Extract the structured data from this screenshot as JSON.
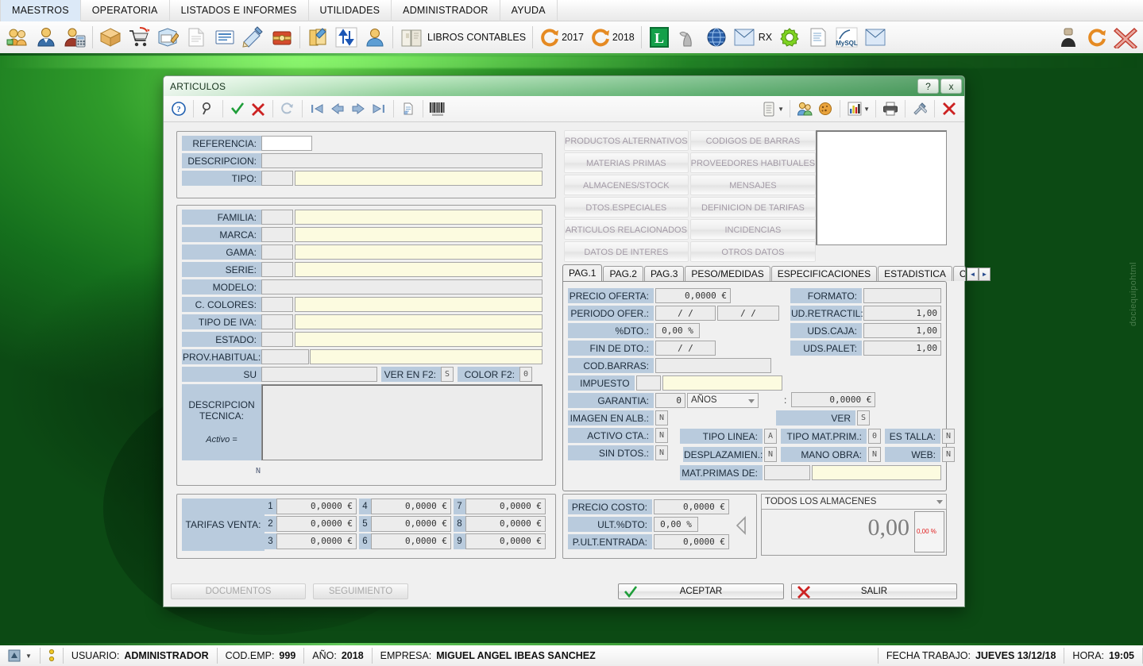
{
  "menubar": {
    "items": [
      "MAESTROS",
      "OPERATORIA",
      "LISTADOS E INFORMES",
      "UTILIDADES",
      "ADMINISTRADOR",
      "AYUDA"
    ]
  },
  "toolbar": {
    "icons": [
      {
        "name": "clientes-icon"
      },
      {
        "name": "proveedores-icon"
      },
      {
        "name": "contabilidad-icon"
      },
      {
        "name": "articulos-icon"
      },
      {
        "name": "compras-carrito-icon"
      },
      {
        "name": "pedidos-icon"
      },
      {
        "name": "albaranes-icon"
      },
      {
        "name": "facturas-icon"
      },
      {
        "name": "firma-icon"
      },
      {
        "name": "caja-icon"
      },
      {
        "name": "agenda-icon"
      },
      {
        "name": "traspasos-icon"
      },
      {
        "name": "usuario-icon"
      }
    ],
    "libros_label": "LIBROS CONTABLES",
    "year_prev": "2017",
    "year_curr": "2018",
    "rx_label": "RX",
    "mysql_label": "MySQL"
  },
  "dialog": {
    "title": "ARTICULOS",
    "help_btn": "?",
    "close_btn": "x",
    "toolbar_icons": [
      {
        "name": "help-icon"
      },
      {
        "name": "search-icon"
      },
      {
        "name": "accept-check-icon"
      },
      {
        "name": "cancel-x-icon"
      },
      {
        "name": "refresh-icon"
      },
      {
        "name": "first-record-icon"
      },
      {
        "name": "prev-record-icon"
      },
      {
        "name": "next-record-icon"
      },
      {
        "name": "last-record-icon"
      },
      {
        "name": "print-preview-icon"
      },
      {
        "name": "barcode-icon"
      }
    ],
    "toolbar_right_icons": [
      {
        "name": "notes-icon"
      },
      {
        "name": "users-icon"
      },
      {
        "name": "cookie-icon"
      },
      {
        "name": "chart-icon"
      },
      {
        "name": "printer-icon"
      },
      {
        "name": "tools-icon"
      },
      {
        "name": "close-red-x-icon"
      }
    ]
  },
  "identification": [
    {
      "label": "REFERENCIA:",
      "value": "",
      "style": "white"
    },
    {
      "label": "DESCRIPCION:",
      "value": "",
      "style": "grey"
    },
    {
      "label": "TIPO:",
      "code": "",
      "value": "",
      "style": "yellow"
    }
  ],
  "classification": [
    {
      "label": "FAMILIA:",
      "code": "",
      "value": "",
      "style": "yellow"
    },
    {
      "label": "MARCA:",
      "code": "",
      "value": "",
      "style": "yellow"
    },
    {
      "label": "GAMA:",
      "code": "",
      "value": "",
      "style": "yellow"
    },
    {
      "label": "SERIE:",
      "code": "",
      "value": "",
      "style": "yellow"
    },
    {
      "label": "MODELO:",
      "code": null,
      "value": "",
      "style": "grey"
    },
    {
      "label": "C. COLORES:",
      "code": "",
      "value": "",
      "style": "yellow"
    },
    {
      "label": "TIPO DE IVA:",
      "code": "",
      "value": "",
      "style": "yellow"
    },
    {
      "label": "ESTADO:",
      "code": "",
      "value": "",
      "style": "yellow"
    },
    {
      "label": "PROV.HABITUAL:",
      "code": "",
      "value": "",
      "style": "yellow"
    }
  ],
  "su_referencia": {
    "label": "SU REFERENCIA:",
    "value": "",
    "ver_en_f2_label": "VER EN F2:",
    "ver_en_f2_value": "S",
    "color_f2_label": "COLOR F2:",
    "color_f2_value": "0"
  },
  "descripcion_tecnica": {
    "label_line1": "DESCRIPCION",
    "label_line2": "TECNICA:",
    "activo_label": "Activo =",
    "activo_value": "N",
    "text": ""
  },
  "side_buttons": {
    "col1": [
      "PRODUCTOS ALTERNATIVOS",
      "MATERIAS PRIMAS",
      "ALMACENES/STOCK",
      "DTOS.ESPECIALES",
      "ARTICULOS RELACIONADOS",
      "DATOS DE INTERES"
    ],
    "col2": [
      "CODIGOS DE BARRAS",
      "PROVEEDORES HABITUALES",
      "MENSAJES",
      "DEFINICION DE TARIFAS",
      "INCIDENCIAS",
      "OTROS DATOS"
    ]
  },
  "tabs": {
    "items": [
      "PAG.1",
      "PAG.2",
      "PAG.3",
      "PESO/MEDIDAS",
      "ESPECIFICACIONES",
      "ESTADISTICA",
      "CALC"
    ],
    "active": "PAG.1",
    "scroll_left": "◄",
    "scroll_right": "►"
  },
  "pag1": {
    "precio_oferta": {
      "label": "PRECIO OFERTA:",
      "value": "0,0000 €"
    },
    "periodo_ofer": {
      "label": "PERIODO OFER.:",
      "from": "/    /",
      "to": "/    /"
    },
    "dto": {
      "label": "%DTO.:",
      "value": "0,00 %"
    },
    "fin_dto": {
      "label": "FIN DE DTO.:",
      "value": "/    /"
    },
    "cod_barras": {
      "label": "COD.BARRAS:",
      "value": ""
    },
    "impuesto_esp": {
      "label": "IMPUESTO ESP.:",
      "code": "",
      "value": "",
      "sep": ":",
      "amount": "0,0000 €"
    },
    "garantia": {
      "label": "GARANTIA:",
      "value": "0",
      "unit": "AÑOS"
    },
    "formato": {
      "label": "FORMATO:",
      "value": ""
    },
    "ud_retractil": {
      "label": "UD.RETRACTIL:",
      "value": "1,00"
    },
    "uds_caja": {
      "label": "UDS.CAJA:",
      "value": "1,00"
    },
    "uds_palet": {
      "label": "UDS.PALET:",
      "value": "1,00"
    },
    "ver_catalogo": {
      "label": "VER CATALOGO:",
      "value": "S"
    },
    "imagen_en_alb": {
      "label": "IMAGEN EN ALB.:",
      "value": "N"
    },
    "tipo_linea": {
      "label": "TIPO LINEA:",
      "value": "A"
    },
    "tipo_mat_prim": {
      "label": "TIPO MAT.PRIM.:",
      "value": "0"
    },
    "es_talla": {
      "label": "ES TALLA:",
      "value": "N"
    },
    "activo_cta": {
      "label": "ACTIVO CTA.:",
      "value": "N"
    },
    "desplazamien": {
      "label": "DESPLAZAMIEN.:",
      "value": "N"
    },
    "mano_obra": {
      "label": "MANO OBRA:",
      "value": "N"
    },
    "web": {
      "label": "WEB:",
      "value": "N"
    },
    "sin_dtos": {
      "label": "SIN DTOS.:",
      "value": "N"
    },
    "mat_primas_de": {
      "label": "MAT.PRIMAS DE:",
      "code": "",
      "value": ""
    }
  },
  "tarifas": {
    "label": "TARIFAS VENTA:",
    "rows": [
      [
        {
          "n": "1",
          "v": "0,0000 €"
        },
        {
          "n": "4",
          "v": "0,0000 €"
        },
        {
          "n": "7",
          "v": "0,0000 €"
        }
      ],
      [
        {
          "n": "2",
          "v": "0,0000 €"
        },
        {
          "n": "5",
          "v": "0,0000 €"
        },
        {
          "n": "8",
          "v": "0,0000 €"
        }
      ],
      [
        {
          "n": "3",
          "v": "0,0000 €"
        },
        {
          "n": "6",
          "v": "0,0000 €"
        },
        {
          "n": "9",
          "v": "0,0000 €"
        }
      ]
    ]
  },
  "costs": {
    "precio_costo": {
      "label": "PRECIO COSTO:",
      "value": "0,0000 €"
    },
    "ult_dto": {
      "label": "ULT.%DTO:",
      "value": "0,00 %"
    },
    "p_ult_entrada": {
      "label": "P.ULT.ENTRADA:",
      "value": "0,0000 €"
    }
  },
  "almacen": {
    "selected": "TODOS LOS ALMACENES",
    "stock_value": "0,00",
    "percent_value": "0,00 %",
    "percent_color": "#e01b1b"
  },
  "footer": {
    "documentos": "DOCUMENTOS",
    "seguimiento": "SEGUIMIENTO",
    "aceptar": "ACEPTAR",
    "salir": "SALIR"
  },
  "statusbar": {
    "usuario_label": "USUARIO:",
    "usuario_value": "ADMINISTRADOR",
    "cod_emp_label": "COD.EMP:",
    "cod_emp_value": "999",
    "anio_label": "AÑO:",
    "anio_value": "2018",
    "empresa_label": "EMPRESA:",
    "empresa_value": "MIGUEL ANGEL IBEAS SANCHEZ",
    "fecha_label": "FECHA TRABAJO:",
    "fecha_value": "JUEVES 13/12/18",
    "hora_label": "HORA:",
    "hora_value": "19:05"
  },
  "desktop": {
    "watermark": "dociequipohtml"
  },
  "colors": {
    "label_bg": "#b9cbdd",
    "yellow_field": "#fcfbe0",
    "accent_green": "#2f8f2c",
    "red": "#d81f1f"
  }
}
